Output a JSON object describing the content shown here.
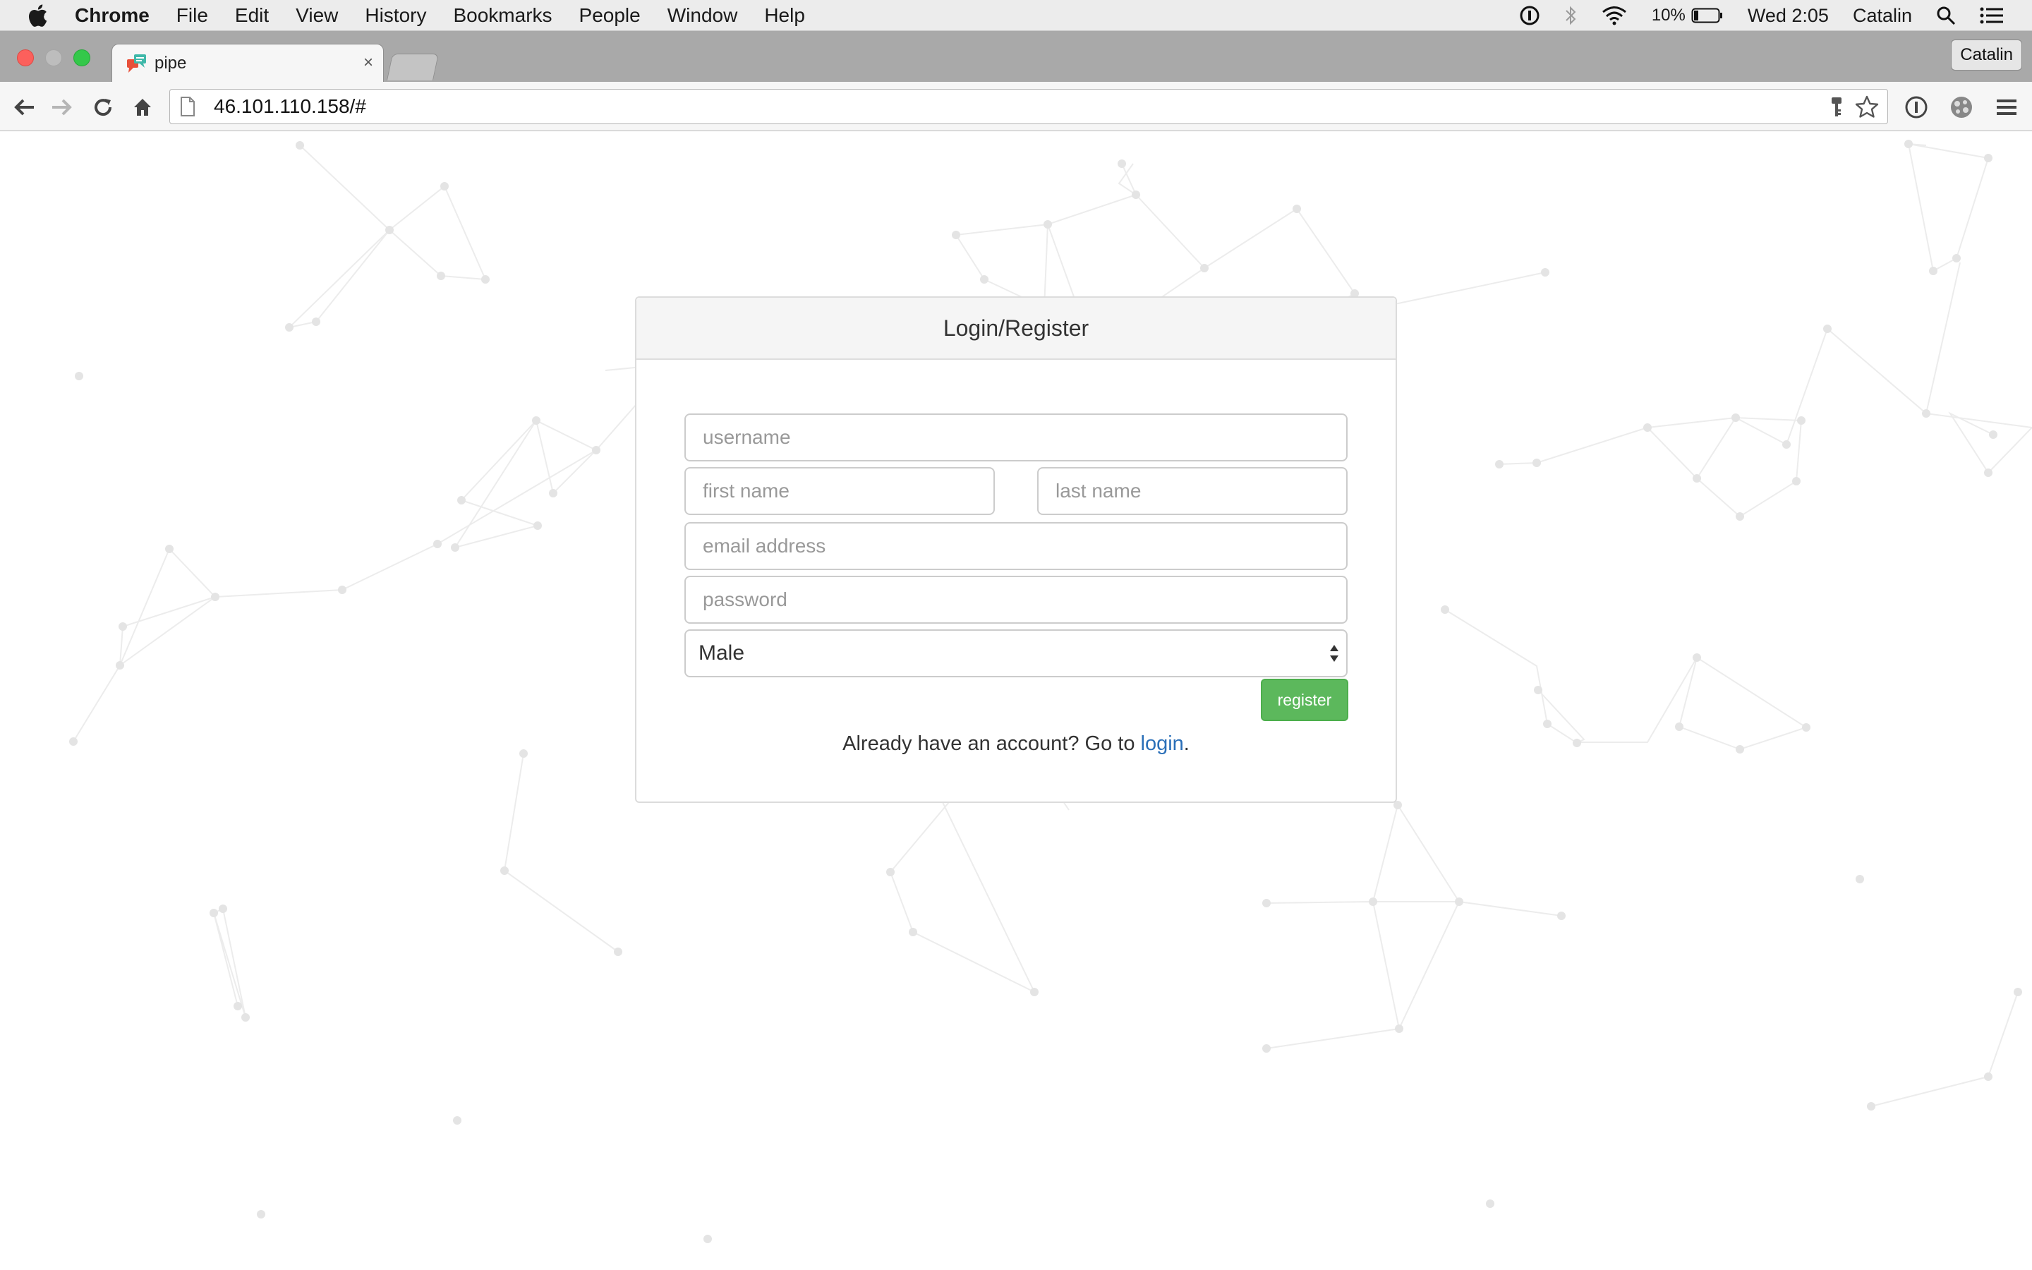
{
  "menubar": {
    "app_name": "Chrome",
    "menus": [
      "File",
      "Edit",
      "View",
      "History",
      "Bookmarks",
      "People",
      "Window",
      "Help"
    ],
    "battery_percent": "10%",
    "clock": "Wed 2:05",
    "user": "Catalin"
  },
  "browser": {
    "tab_title": "pipe",
    "tab_close": "×",
    "profile_label": "Catalin",
    "url": "46.101.110.158/#"
  },
  "form": {
    "heading": "Login/Register",
    "username_placeholder": "username",
    "first_name_placeholder": "first name",
    "last_name_placeholder": "last name",
    "email_placeholder": "email address",
    "password_placeholder": "password",
    "gender_selected": "Male",
    "register_label": "register",
    "login_prompt": "Already have an account? Go to",
    "login_link": "login",
    "login_suffix": "."
  },
  "colors": {
    "register_green": "#5cb85c",
    "link_blue": "#2a6fb8",
    "network_lines": "#e9e9e9"
  }
}
